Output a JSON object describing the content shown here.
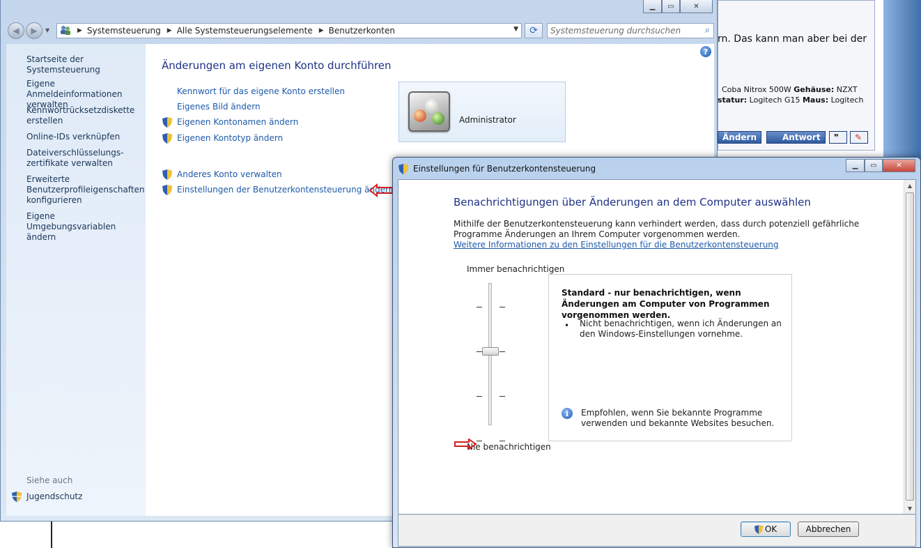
{
  "background": {
    "forum_line1": "rn. Das kann man aber bei der",
    "forum_line2_a": "Coba Nitrox 500W",
    "forum_line2_b": "Gehäuse:",
    "forum_line2_c": "NZXT",
    "forum_line3_a": "statur:",
    "forum_line3_b": "Logitech G15",
    "forum_line3_c": "Maus:",
    "forum_line3_d": "Logitech",
    "btn_aendern": "Ändern",
    "btn_antwort": "Antwort"
  },
  "control_panel": {
    "breadcrumbs": [
      "Systemsteuerung",
      "Alle Systemsteuerungselemente",
      "Benutzerkonten"
    ],
    "search_placeholder": "Systemsteuerung durchsuchen",
    "sidebar": {
      "items": [
        "Startseite der Systemsteuerung",
        "Eigene Anmeldeinformationen verwalten",
        "Kennwortrücksetzdiskette erstellen",
        "Online-IDs verknüpfen",
        "Dateiverschlüsselungs-zertifikate verwalten",
        "Erweiterte Benutzerprofileigenschaften konfigurieren",
        "Eigene Umgebungsvariablen ändern"
      ],
      "see_also": "Siehe auch",
      "jugendschutz": "Jugendschutz"
    },
    "main": {
      "title": "Änderungen am eigenen Konto durchführen",
      "tasks": [
        "Kennwort für das eigene Konto erstellen",
        "Eigenes Bild ändern",
        "Eigenen Kontonamen ändern",
        "Eigenen Kontotyp ändern"
      ],
      "other_tasks": [
        "Anderes Konto verwalten",
        "Einstellungen der Benutzerkontensteuerung ändern"
      ],
      "account_name": "Administrator"
    }
  },
  "uac_dialog": {
    "title": "Einstellungen für Benutzerkontensteuerung",
    "heading": "Benachrichtigungen über Änderungen an dem Computer auswählen",
    "description": "Mithilfe der Benutzerkontensteuerung kann verhindert werden, dass durch potenziell gefährliche Programme Änderungen an Ihrem Computer vorgenommen werden.",
    "more_info_link": "Weitere Informationen zu den Einstellungen für die Benutzerkontensteuerung",
    "top_label": "Immer benachrichtigen",
    "bottom_label": "Nie benachrichtigen",
    "slider_level": 3,
    "slider_levels_total": 4,
    "info_title": "Standard - nur benachrichtigen, wenn Änderungen am Computer von Programmen vorgenommen werden.",
    "info_bullet": "Nicht benachrichtigen, wenn ich Änderungen an den Windows-Einstellungen vornehme.",
    "info_recommend": "Empfohlen, wenn Sie bekannte Programme verwenden und bekannte Websites besuchen.",
    "ok_label": "OK",
    "cancel_label": "Abbrechen"
  },
  "colors": {
    "link": "#1d5aab",
    "heading": "#1e3287",
    "annotation_arrow": "#d42020"
  }
}
